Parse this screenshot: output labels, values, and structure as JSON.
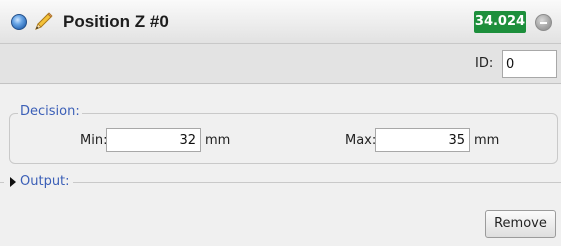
{
  "header": {
    "title": "Position Z #0",
    "value": "34.024",
    "status_icon": "status-dot-icon",
    "edit_icon": "pencil-icon",
    "collapse_icon": "minus-circle-icon",
    "value_color": "#1d8f3c"
  },
  "id_row": {
    "label": "ID:",
    "value": "0"
  },
  "decision": {
    "legend": "Decision:",
    "min_label": "Min:",
    "min_value": "32",
    "min_unit": "mm",
    "max_label": "Max:",
    "max_value": "35",
    "max_unit": "mm"
  },
  "output": {
    "label": "Output:",
    "expanded": false
  },
  "actions": {
    "remove_label": "Remove"
  },
  "colors": {
    "accent_text": "#3b5fb7"
  }
}
